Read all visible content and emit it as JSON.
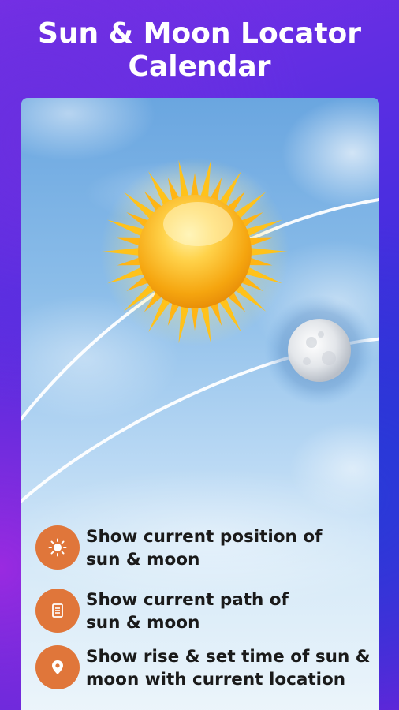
{
  "header": {
    "title_line1": "Sun & Moon Locator",
    "title_line2": "Calendar"
  },
  "features": [
    {
      "icon": "sun-icon",
      "line1": "Show current position of",
      "line2": "sun & moon"
    },
    {
      "icon": "calendar-icon",
      "line1": "Show current path of",
      "line2": "sun & moon"
    },
    {
      "icon": "location-pin-icon",
      "line1": "Show rise & set time of sun &",
      "line2": "moon with current location"
    }
  ],
  "colors": {
    "accent": "#e0763a",
    "background_top": "#7b2fe6",
    "background_bottom": "#2b2fd6"
  }
}
